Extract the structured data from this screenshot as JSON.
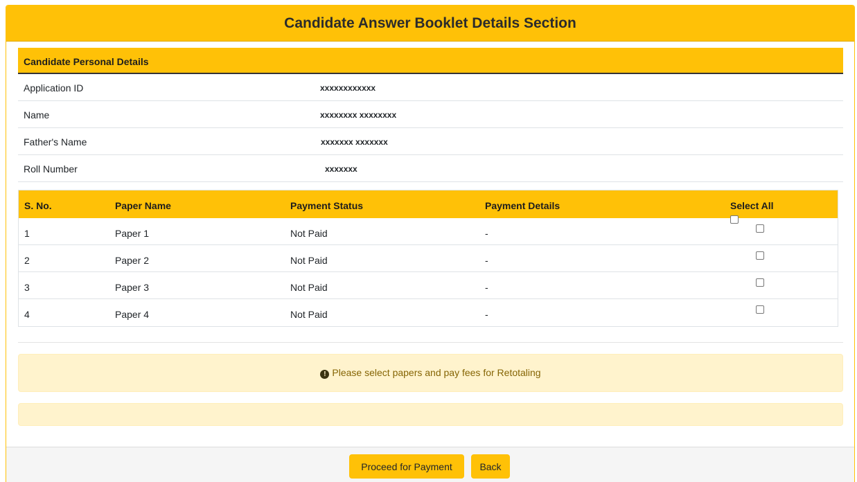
{
  "header": {
    "title": "Candidate Answer Booklet Details Section"
  },
  "personal": {
    "title": "Candidate Personal Details",
    "rows": [
      {
        "label": "Application ID",
        "value": "xxxxxxxxxxxx"
      },
      {
        "label": "Name",
        "value": "xxxxxxxx xxxxxxxx"
      },
      {
        "label": "Father's Name",
        "value": "xxxxxxx xxxxxxx"
      },
      {
        "label": "Roll Number",
        "value": "xxxxxxx"
      }
    ]
  },
  "papers": {
    "headers": {
      "sno": "S. No.",
      "paper_name": "Paper Name",
      "payment_status": "Payment Status",
      "payment_details": "Payment Details",
      "select_all": "Select All"
    },
    "rows": [
      {
        "sno": "1",
        "paper_name": "Paper 1",
        "payment_status": "Not Paid",
        "payment_details": "-"
      },
      {
        "sno": "2",
        "paper_name": "Paper 2",
        "payment_status": "Not Paid",
        "payment_details": "-"
      },
      {
        "sno": "3",
        "paper_name": "Paper 3",
        "payment_status": "Not Paid",
        "payment_details": "-"
      },
      {
        "sno": "4",
        "paper_name": "Paper 4",
        "payment_status": "Not Paid",
        "payment_details": "-"
      }
    ]
  },
  "alert": {
    "icon": "exclamation-circle-icon",
    "text": "Please select papers and pay fees for Retotaling"
  },
  "footer": {
    "proceed_label": "Proceed for Payment",
    "back_label": "Back"
  },
  "colors": {
    "accent": "#ffc107",
    "alert_bg": "#fff3cd"
  }
}
